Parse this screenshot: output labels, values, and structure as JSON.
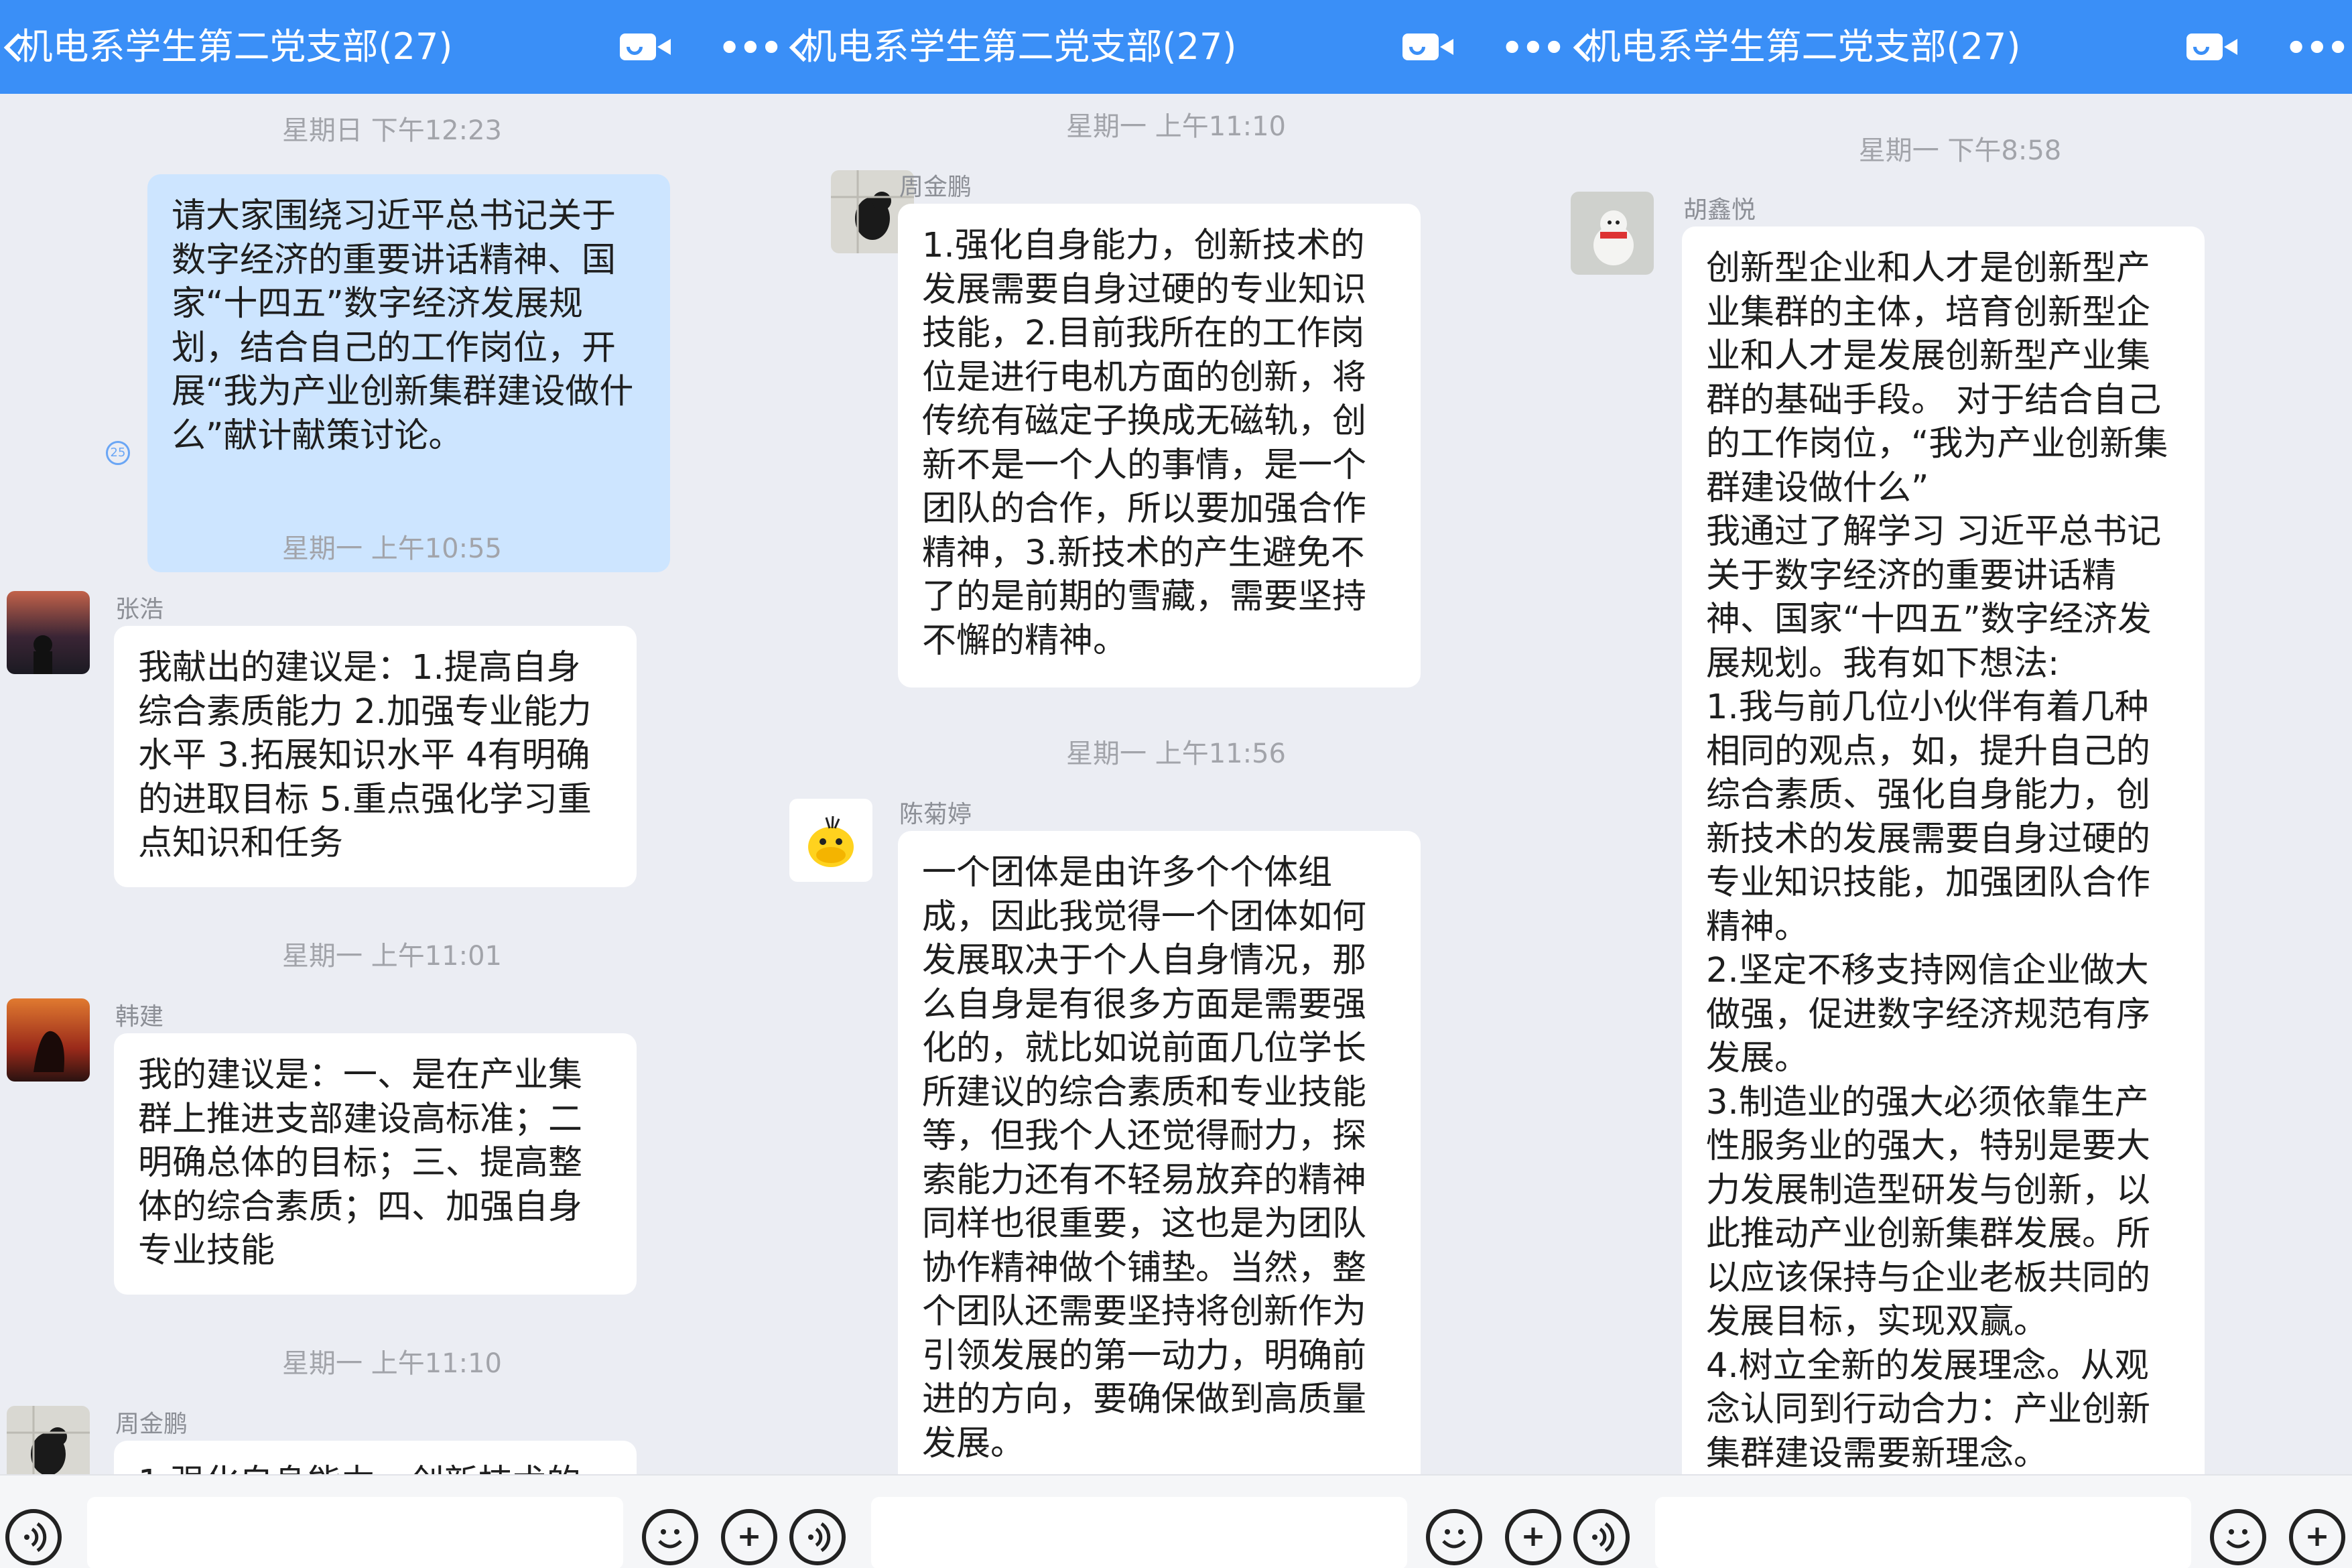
{
  "header": {
    "title": "机电系学生第二党支部(27)",
    "more_glyph": "•••",
    "icons": [
      "back-icon",
      "video-call-icon",
      "more-icon"
    ]
  },
  "accent_color": "#3a8ff7",
  "panel1": {
    "ts1": "星期日 下午12:23",
    "msg_self": "请大家围绕习近平总书记关于数字经济的重要讲话精神、国家“十四五”数字经济发展规划，结合自己的工作岗位，开展“我为产业创新集群建设做什么”献计献策讨论。",
    "read_count": "25",
    "ts2": "星期一 上午10:55",
    "name1": "张浩",
    "msg1": "我献出的建议是：1.提高自身综合素质能力 2.加强专业能力水平 3.拓展知识水平 4有明确的进取目标 5.重点强化学习重点知识和任务",
    "ts3": "星期一 上午11:01",
    "name2": "韩建",
    "msg2": "我的建议是：一、是在产业集群上推进支部建设高标准；二明确总体的目标；三、提高整体的综合素质；四、加强自身专业技能",
    "ts4": "星期一 上午11:10",
    "name3": "周金鹏",
    "msg3": "1.强化自身能力，创新技术的"
  },
  "panel2": {
    "ts1": "星期一 上午11:10",
    "name1": "周金鹏",
    "msg1": "1.强化自身能力，创新技术的发展需要自身过硬的专业知识技能，2.目前我所在的工作岗位是进行电机方面的创新，将传统有磁定子换成无磁轨，创新不是一个人的事情，是一个团队的合作，所以要加强合作精神，3.新技术的产生避免不了的是前期的雪藏，需要坚持不懈的精神。",
    "ts2": "星期一 上午11:56",
    "name2": "陈菊婷",
    "msg2": "一个团体是由许多个个体组成，因此我觉得一个团体如何发展取决于个人自身情况，那么自身是有很多方面是需要强化的，就比如说前面几位学长所建议的综合素质和专业技能等，但我个人还觉得耐力，探索能力还有不轻易放弃的精神同样也很重要，这也是为团队协作精神做个铺垫。当然，整个团队还需要坚持将创新作为引领发展的第一动力，明确前进的方向，要确保做到高质量发展。"
  },
  "panel3": {
    "ts1": "星期一 下午8:58",
    "name1": "胡鑫悦",
    "msg1": "创新型企业和人才是创新型产业集群的主体，培育创新型企业和人才是发展创新型产业集群的基础手段。 对于结合自己的工作岗位，“我为产业创新集群建设做什么”\n我通过了解学习 习近平总书记关于数字经济的重要讲话精神、国家“十四五”数字经济发展规划。我有如下想法:\n1.我与前几位小伙伴有着几种相同的观点，如，提升自己的综合素质、强化自身能力，创新技术的发展需要自身过硬的专业知识技能，加强团队合作精神。\n2.坚定不移支持网信企业做大做强，促进数字经济规范有序发展。\n3.制造业的强大必须依靠生产性服务业的强大，特别是要大力发展制造型研发与创新，以此推动产业创新集群发展。所以应该保持与企业老板共同的发展目标，实现双赢。\n4.树立全新的发展理念。从观念认同到行动合力：产业创新集群建设需要新理念。"
  },
  "bottom": {
    "plus_glyph": "+",
    "icons": [
      "voice-icon",
      "emoji-icon",
      "plus-icon"
    ]
  }
}
